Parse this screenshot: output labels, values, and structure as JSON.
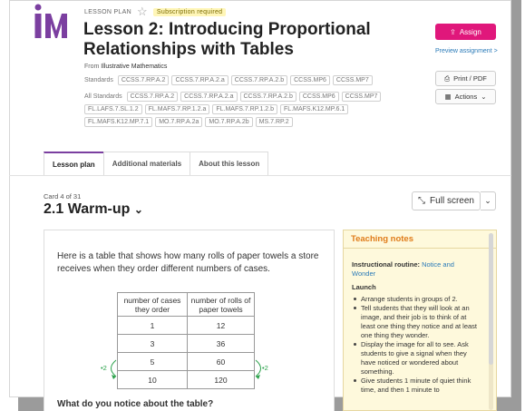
{
  "header": {
    "lesson_plan_label": "LESSON PLAN",
    "subscription_badge": "Subscription required",
    "title_line1": "Lesson 2: Introducing Proportional",
    "title_line2": "Relationships with Tables",
    "from_prefix": "From",
    "from_source": "Illustrative Mathematics",
    "standards_label": "Standards",
    "standards": [
      "CCSS.7.RP.A.2",
      "CCSS.7.RP.A.2.a",
      "CCSS.7.RP.A.2.b",
      "CCSS.MP6",
      "CCSS.MP7"
    ],
    "all_standards_label": "All Standards",
    "all_standards": [
      "CCSS.7.RP.A.2",
      "CCSS.7.RP.A.2.a",
      "CCSS.7.RP.A.2.b",
      "CCSS.MP6",
      "CCSS.MP7",
      "FL.LAFS.7.SL.1.2",
      "FL.MAFS.7.RP.1.2.a",
      "FL.MAFS.7.RP.1.2.b",
      "FL.MAFS.K12.MP.6.1",
      "FL.MAFS.K12.MP.7.1",
      "MO.7.RP.A.2a",
      "MO.7.RP.A.2b",
      "MS.7.RP.2"
    ]
  },
  "actions": {
    "assign_label": "Assign",
    "preview_label": "Preview assignment >",
    "print_label": "Print / PDF",
    "actions_label": "Actions"
  },
  "tabs": [
    {
      "label": "Lesson plan",
      "active": true
    },
    {
      "label": "Additional materials",
      "active": false
    },
    {
      "label": "About this lesson",
      "active": false
    }
  ],
  "card": {
    "count": "Card 4 of 31",
    "title": "2.1 Warm-up",
    "full_screen_label": "Full screen"
  },
  "content": {
    "intro": "Here is a table that shows how many rolls of paper towels a store receives when they order different numbers of cases.",
    "table_headers": [
      "number of cases they order",
      "number of rolls of paper towels"
    ],
    "table_rows": [
      [
        "1",
        "12"
      ],
      [
        "3",
        "36"
      ],
      [
        "5",
        "60"
      ],
      [
        "10",
        "120"
      ]
    ],
    "left_arrow_label": "•2",
    "right_arrow_label": "•2",
    "question": "What do you notice about the table?"
  },
  "notes": {
    "title": "Teaching notes",
    "routine_label": "Instructional routine:",
    "routine_link": "Notice and Wonder",
    "launch_label": "Launch",
    "bullets": [
      "Arrange students in groups of 2.",
      "Tell students that they will look at an image, and their job is to think of at least one thing they notice and at least one thing they wonder.",
      "Display the image for all to see. Ask students to give a signal when they have noticed or wondered about something.",
      "Give students 1 minute of quiet think time, and then 1 minute to"
    ]
  },
  "colors": {
    "brand_purple": "#7b3fa0",
    "assign_pink": "#e0177b",
    "link_blue": "#2a7ab8",
    "notes_orange": "#e07c1a",
    "arrow_green": "#2aa14a",
    "badge_yellow": "#fff6b8"
  }
}
